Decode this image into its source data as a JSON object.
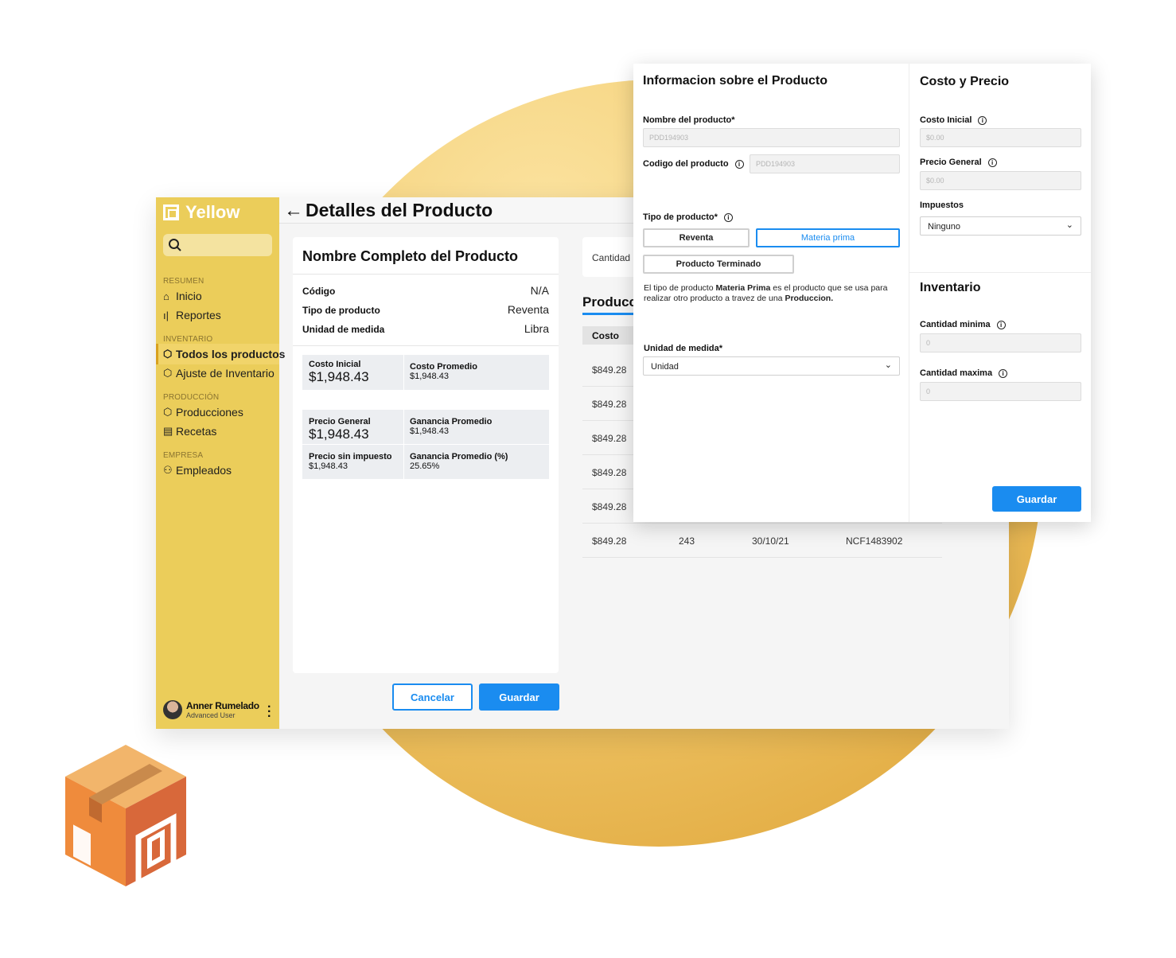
{
  "sidebar": {
    "logo": "Yellow",
    "sections": {
      "resumen": "RESUMEN",
      "inventario": "INVENTARIO",
      "produccion": "PRODUCCIÓN",
      "empresa": "EMPRESA"
    },
    "items": {
      "inicio": "Inicio",
      "reportes": "Reportes",
      "todos": "Todos los productos",
      "ajuste": "Ajuste de Inventario",
      "producciones": "Producciones",
      "recetas": "Recetas",
      "empleados": "Empleados"
    },
    "user": {
      "name": "Anner Rumelado",
      "role": "Advanced User"
    }
  },
  "header": {
    "title": "Detalles del Producto"
  },
  "product_card": {
    "title": "Nombre Completo del Producto",
    "codigo_label": "Código",
    "codigo_value": "N/A",
    "tipo_label": "Tipo de producto",
    "tipo_value": "Reventa",
    "unidad_label": "Unidad de medida",
    "unidad_value": "Libra",
    "costo_inicial_label": "Costo Inicial",
    "costo_inicial_value": "$1,948.43",
    "costo_promedio_label": "Costo Promedio",
    "costo_promedio_value": "$1,948.43",
    "precio_general_label": "Precio General",
    "precio_general_value": "$1,948.43",
    "ganancia_promedio_label": "Ganancia Promedio",
    "ganancia_promedio_value": "$1,948.43",
    "precio_sin_label": "Precio sin impuesto",
    "precio_sin_value": "$1,948.43",
    "ganancia_pct_label": "Ganancia Promedio (%)",
    "ganancia_pct_value": "25.65%"
  },
  "actions": {
    "cancel": "Cancelar",
    "save": "Guardar"
  },
  "right_panel": {
    "cantidad_label": "Cantidad",
    "producciones_title": "Producci",
    "table_header": "Costo",
    "rows": [
      {
        "costo": "$849.28"
      },
      {
        "costo": "$849.28"
      },
      {
        "costo": "$849.28"
      },
      {
        "costo": "$849.28"
      },
      {
        "costo": "$849.28"
      },
      {
        "costo": "$849.28",
        "cantidad": "243",
        "fecha": "30/10/21",
        "ncf": "NCF1483902"
      }
    ]
  },
  "modal": {
    "info_title": "Informacion sobre el Producto",
    "nombre_label": "Nombre del producto*",
    "nombre_placeholder": "PDD194903",
    "codigo_label": "Codigo del producto",
    "codigo_placeholder": "PDD194903",
    "tipo_label": "Tipo de producto*",
    "tipo_options": [
      "Reventa",
      "Materia prima",
      "Producto Terminado"
    ],
    "tipo_selected": "Materia prima",
    "desc_1": "El tipo de producto ",
    "desc_bold1": "Materia Prima",
    "desc_2": " es el producto que se usa para realizar otro producto a travez de una ",
    "desc_bold2": "Produccion.",
    "unidad_label": "Unidad de medida*",
    "unidad_value": "Unidad",
    "costo_title": "Costo y Precio",
    "costo_inicial_label": "Costo Inicial",
    "costo_inicial_placeholder": "$0.00",
    "precio_general_label": "Precio General",
    "precio_general_placeholder": "$0.00",
    "impuestos_label": "Impuestos",
    "impuestos_value": "Ninguno",
    "inventario_title": "Inventario",
    "cant_min_label": "Cantidad minima",
    "cant_min_placeholder": "0",
    "cant_max_label": "Cantidad maxima",
    "cant_max_placeholder": "0",
    "save": "Guardar"
  },
  "colors": {
    "accent": "#1a8cf0",
    "sidebar": "#ebcd5a",
    "brand_circle": "#f4cf75"
  }
}
